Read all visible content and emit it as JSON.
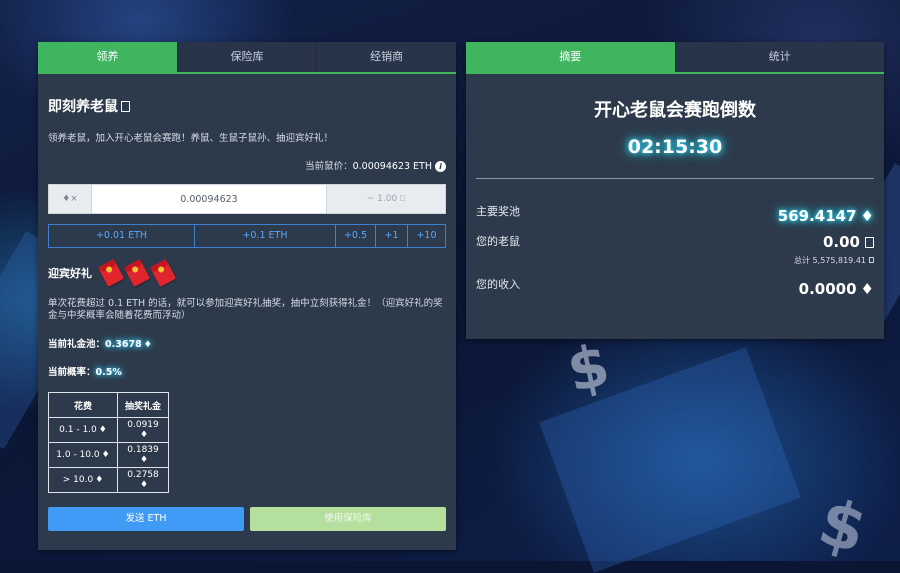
{
  "left_tabs": [
    "领养",
    "保险库",
    "经销商"
  ],
  "left": {
    "title": "即刻养老鼠",
    "intro": "领养老鼠，加入开心老鼠会赛跑！养鼠、生鼠子鼠孙、抽迎宾好礼！",
    "price_label": "当前鼠价：",
    "price_value": "0.00094623 ETH",
    "input_addon": "× ",
    "input_value": "0.00094623",
    "input_right": "~ 1.00",
    "quick_buttons": [
      "+0.01 ETH",
      "+0.1 ETH",
      "+0.5",
      "+1",
      "+10"
    ],
    "bonus_title": "迎宾好礼",
    "bonus_desc": "单次花费超过 0.1 ETH 的话，就可以参加迎宾好礼抽奖，抽中立刻获得礼金！（迎宾好礼的奖金与中奖概率会随着花费而浮动）",
    "pool_label": "当前礼金池：",
    "pool_value": "0.3678",
    "odds_label": "当前概率：",
    "odds_value": "0.5%",
    "table_headers": [
      "花费",
      "抽奖礼金"
    ],
    "table_rows": [
      [
        "0.1 - 1.0",
        "0.0919"
      ],
      [
        "1.0 - 10.0",
        "0.1839"
      ],
      [
        "> 10.0",
        "0.2758"
      ]
    ],
    "send_button": "发送 ETH",
    "vault_button": "使用保险库"
  },
  "right_tabs": [
    "摘要",
    "统计"
  ],
  "right": {
    "title": "开心老鼠会赛跑倒数",
    "countdown": "02:15:30",
    "pool_label": "主要奖池",
    "pool_value": "569.4147",
    "mice_label": "您的老鼠",
    "mice_value": "0.00",
    "mice_total": "总计 5,575,819.41",
    "income_label": "您的收入",
    "income_value": "0.0000"
  },
  "icons": {
    "eth": "ethereum-icon",
    "info": "info-icon",
    "mouse": "mouse-icon",
    "envelope": "red-envelope-icon"
  },
  "colors": {
    "accent_green": "#3fb55f",
    "button_blue": "#3f9bf5",
    "button_green_disabled": "#b4df9c",
    "panel_bg": "#2d3a4b",
    "glow_cyan": "#2ce0ff"
  }
}
